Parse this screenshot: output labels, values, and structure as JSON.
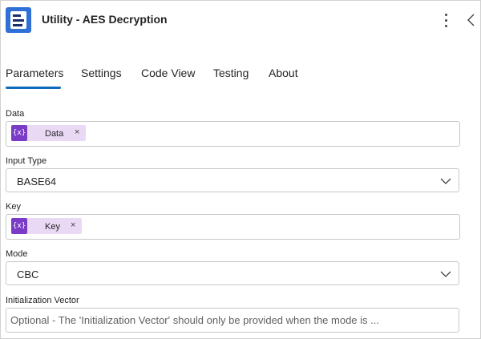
{
  "header": {
    "title": "Utility - AES Decryption",
    "icon": "app-logo-icon",
    "more_icon": "more-vertical-icon",
    "collapse_icon": "chevron-left-icon"
  },
  "tabs": [
    {
      "label": "Parameters",
      "active": true
    },
    {
      "label": "Settings",
      "active": false
    },
    {
      "label": "Code View",
      "active": false
    },
    {
      "label": "Testing",
      "active": false
    },
    {
      "label": "About",
      "active": false
    }
  ],
  "fields": {
    "data": {
      "label": "Data",
      "token_icon": "{x}",
      "token_text": "Data",
      "remove": "×"
    },
    "input_type": {
      "label": "Input Type",
      "value": "BASE64"
    },
    "key": {
      "label": "Key",
      "token_icon": "{x}",
      "token_text": "Key",
      "remove": "×"
    },
    "mode": {
      "label": "Mode",
      "value": "CBC"
    },
    "iv": {
      "label": "Initialization Vector",
      "placeholder": "Optional - The 'Initialization Vector' should only be provided when the mode is ..."
    }
  },
  "colors": {
    "accent": "#0f6cbd",
    "token_bg": "#ead9f5",
    "token_icon_bg": "#7a3cc7",
    "app_icon_bg": "#2f6fd6"
  }
}
